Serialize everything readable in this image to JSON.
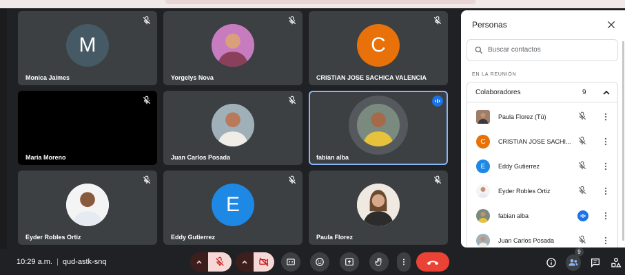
{
  "tiles": [
    {
      "name": "Monica Jaimes",
      "initial": "M",
      "color": "#455a64"
    },
    {
      "name": "Yorgelys Nova"
    },
    {
      "name": "CRISTIAN JOSE SACHICA VALENCIA",
      "initial": "C",
      "color": "#e8710a"
    },
    {
      "name": "Maria Moreno"
    },
    {
      "name": "Juan Carlos Posada"
    },
    {
      "name": "fabian alba"
    },
    {
      "name": "Eyder Robles Ortiz"
    },
    {
      "name": "Eddy Gutierrez",
      "initial": "E",
      "color": "#1e88e5"
    },
    {
      "name": "Paula Florez"
    }
  ],
  "bottombar": {
    "time": "10:29 a.m.",
    "separator": "|",
    "code": "qud-astk-snq",
    "participant_count": "9"
  },
  "panel": {
    "title": "Personas",
    "search_placeholder": "Buscar contactos",
    "section": "EN LA REUNIÓN",
    "group_label": "Colaboradores",
    "group_count": "9",
    "participants": [
      {
        "name": "Paula Florez (Tú)"
      },
      {
        "name": "CRISTIAN JOSE SACHI...",
        "initial": "C",
        "color": "#e8710a"
      },
      {
        "name": "Eddy Gutierrez",
        "initial": "E",
        "color": "#1e88e5"
      },
      {
        "name": "Eyder Robles Ortiz"
      },
      {
        "name": "fabian alba"
      },
      {
        "name": "Juan Carlos Posada"
      }
    ]
  },
  "colors": {
    "accent": "#1a73e8",
    "end_call": "#ea4335",
    "tile_bg": "#3c4043",
    "page_bg": "#202124"
  }
}
